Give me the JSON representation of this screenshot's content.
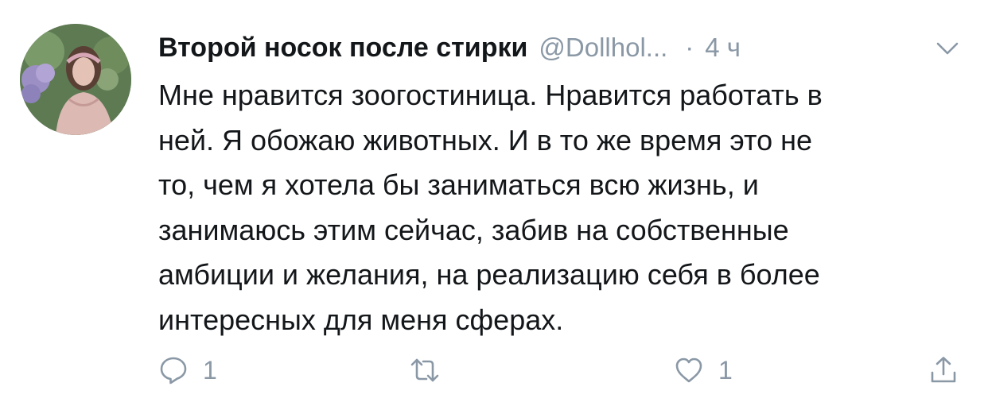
{
  "tweet": {
    "display_name": "Второй носок после стирки",
    "handle": "@Dollhol...",
    "separator": "·",
    "time": "4 ч",
    "text_lines": [
      "Мне нравится зоогостиница. Нравится работать в",
      "ней. Я обожаю животных. И в то же время это не",
      "то, чем я хотела бы заниматься всю жизнь, и",
      "занимаюсь этим сейчас, забив на собственные",
      "амбиции и желания, на реализацию себя в более",
      "интересных для меня сферах."
    ],
    "actions": {
      "reply_count": "1",
      "retweet_count": "",
      "like_count": "1"
    }
  },
  "colors": {
    "text": "#14171a",
    "muted": "#8a98a6",
    "background": "#ffffff"
  },
  "icons": {
    "menu": "chevron-down-icon",
    "reply": "reply-icon",
    "retweet": "retweet-icon",
    "like": "heart-icon",
    "share": "share-icon"
  }
}
